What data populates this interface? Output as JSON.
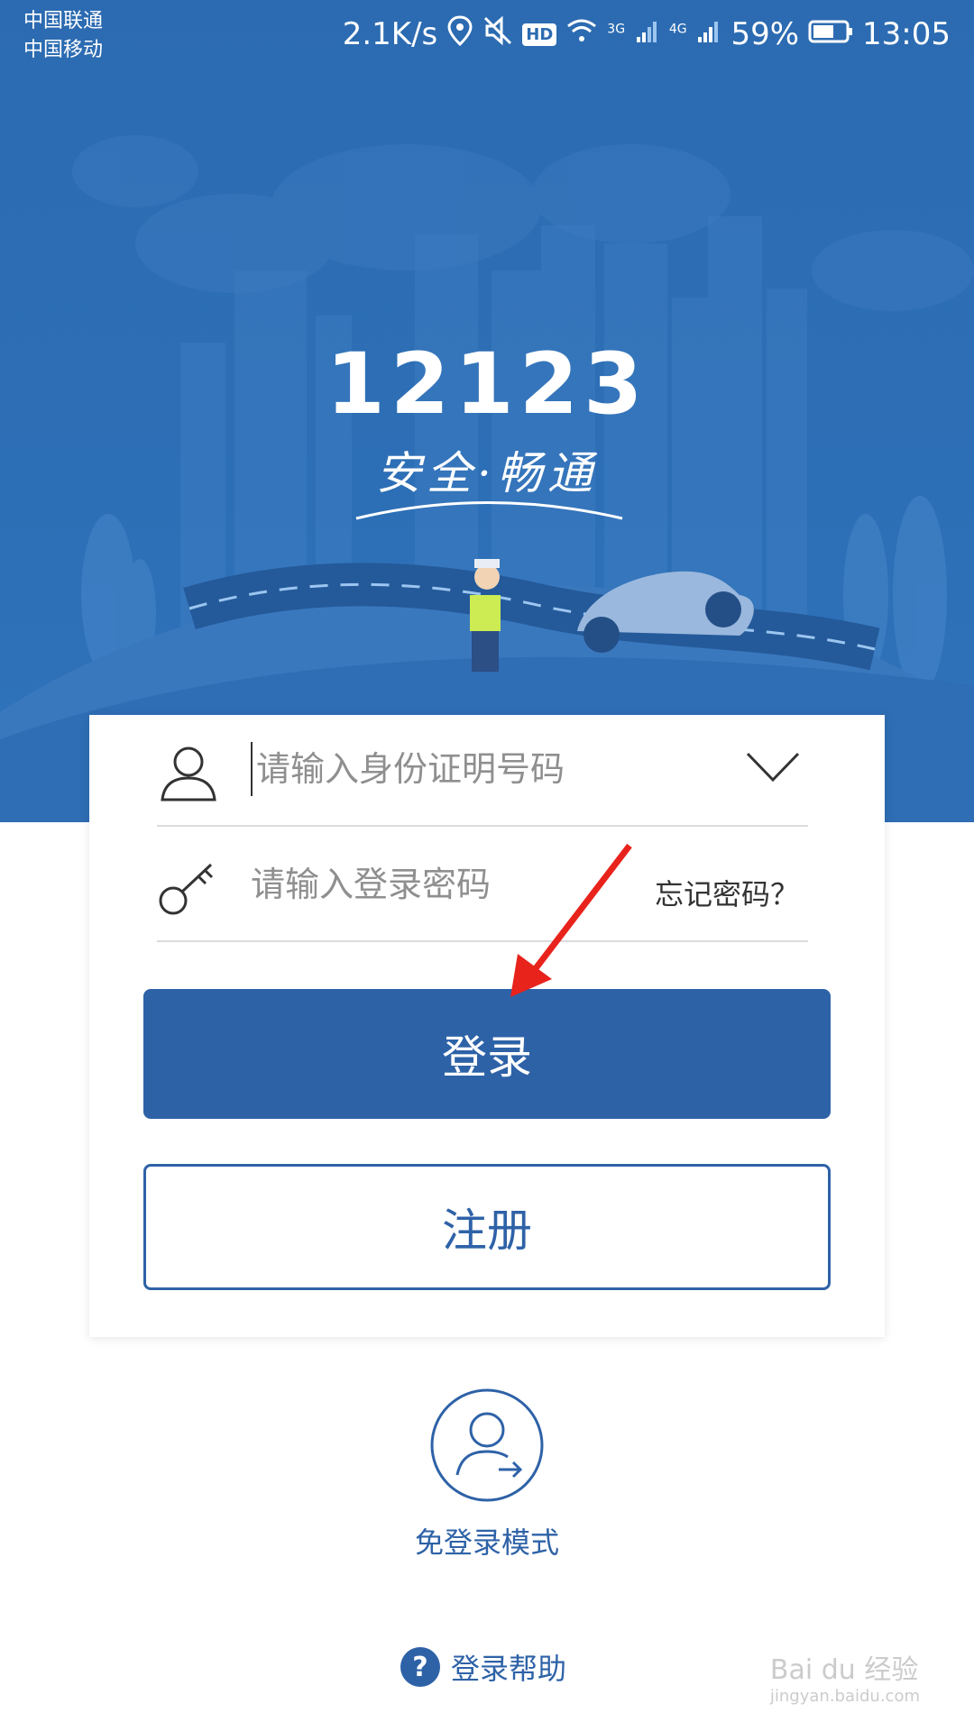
{
  "status_bar": {
    "carrier_1": "中国联通",
    "carrier_2": "中国移动",
    "speed": "2.1K/s",
    "hd": "HD",
    "net_3g": "3G",
    "net_4g": "4G",
    "battery": "59%",
    "time": "13:05"
  },
  "hero": {
    "logo": "12123",
    "slogan": "安全·畅通"
  },
  "login_form": {
    "id_placeholder": "请输入身份证明号码",
    "password_placeholder": "请输入登录密码",
    "forgot_password": "忘记密码？",
    "login_button": "登录",
    "register_button": "注册"
  },
  "guest_mode": {
    "label": "免登录模式"
  },
  "help": {
    "icon_text": "?",
    "label": "登录帮助"
  },
  "watermark": {
    "brand": "Bai du 经验",
    "url": "jingyan.baidu.com"
  },
  "colors": {
    "brand_blue": "#2e62a7",
    "hero_blue": "#2c6bb1",
    "annotation_red": "#e8231c"
  },
  "icons": [
    "location-icon",
    "mute-icon",
    "wifi-icon",
    "signal-icon",
    "battery-icon",
    "user-icon",
    "key-icon",
    "chevron-down-icon",
    "guest-user-icon",
    "help-icon"
  ]
}
